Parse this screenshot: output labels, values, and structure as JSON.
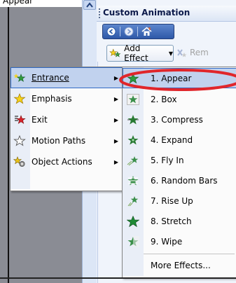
{
  "caption": {
    "text": "Appear ‘"
  },
  "task_pane": {
    "title": "Custom Animation",
    "add_effect_label": "Add Effect",
    "remove_label": "Rem"
  },
  "menu": {
    "items": [
      {
        "label": "Entrance",
        "icon": "green-star-icon",
        "selected": true
      },
      {
        "label": "Emphasis",
        "icon": "yellow-star-icon"
      },
      {
        "label": "Exit",
        "icon": "red-star-icon"
      },
      {
        "label": "Motion Paths",
        "icon": "outline-star-icon"
      },
      {
        "label": "Object Actions",
        "icon": "object-actions-icon"
      }
    ]
  },
  "submenu": {
    "items": [
      {
        "label": "1. Appear",
        "selected": true
      },
      {
        "label": "2. Box"
      },
      {
        "label": "3. Compress"
      },
      {
        "label": "4. Expand"
      },
      {
        "label": "5. Fly In"
      },
      {
        "label": "6. Random Bars"
      },
      {
        "label": "7. Rise Up"
      },
      {
        "label": "8. Stretch"
      },
      {
        "label": "9. Wipe"
      }
    ],
    "more_label": "More Effects..."
  },
  "colors": {
    "highlight": "#c1d2ee",
    "ellipse": "#e0262b",
    "accent": "#316ac5"
  }
}
